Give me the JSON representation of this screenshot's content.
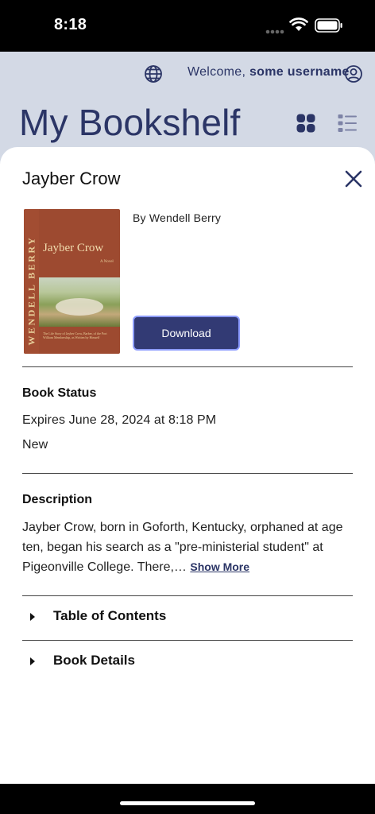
{
  "status_bar": {
    "time": "8:18"
  },
  "header": {
    "welcome_prefix": "Welcome, ",
    "username": "some username",
    "page_title": "My Bookshelf"
  },
  "book": {
    "title": "Jayber Crow",
    "author": "By Wendell Berry",
    "download_label": "Download",
    "cover": {
      "spine_text": "WENDELL BERRY",
      "title": "Jayber Crow",
      "subtitle": "A Novel",
      "blurb": "The Life Story of Jayber Crow, Barber, of the Port William Membership, as Written by Himself"
    }
  },
  "status_section": {
    "heading": "Book Status",
    "expires": "Expires June 28, 2024 at 8:18 PM",
    "state": "New"
  },
  "description_section": {
    "heading": "Description",
    "text": "Jayber Crow, born in Goforth, Kentucky, orphaned at age ten, began his search as a \"pre-ministerial student\" at Pigeonville College. There,… ",
    "show_more": "Show More"
  },
  "disclosures": [
    {
      "label": "Table of Contents"
    },
    {
      "label": "Book Details"
    }
  ],
  "colors": {
    "brand_navy": "#2b3566",
    "button": "#323a74",
    "header_bg": "#d3d9e5"
  }
}
